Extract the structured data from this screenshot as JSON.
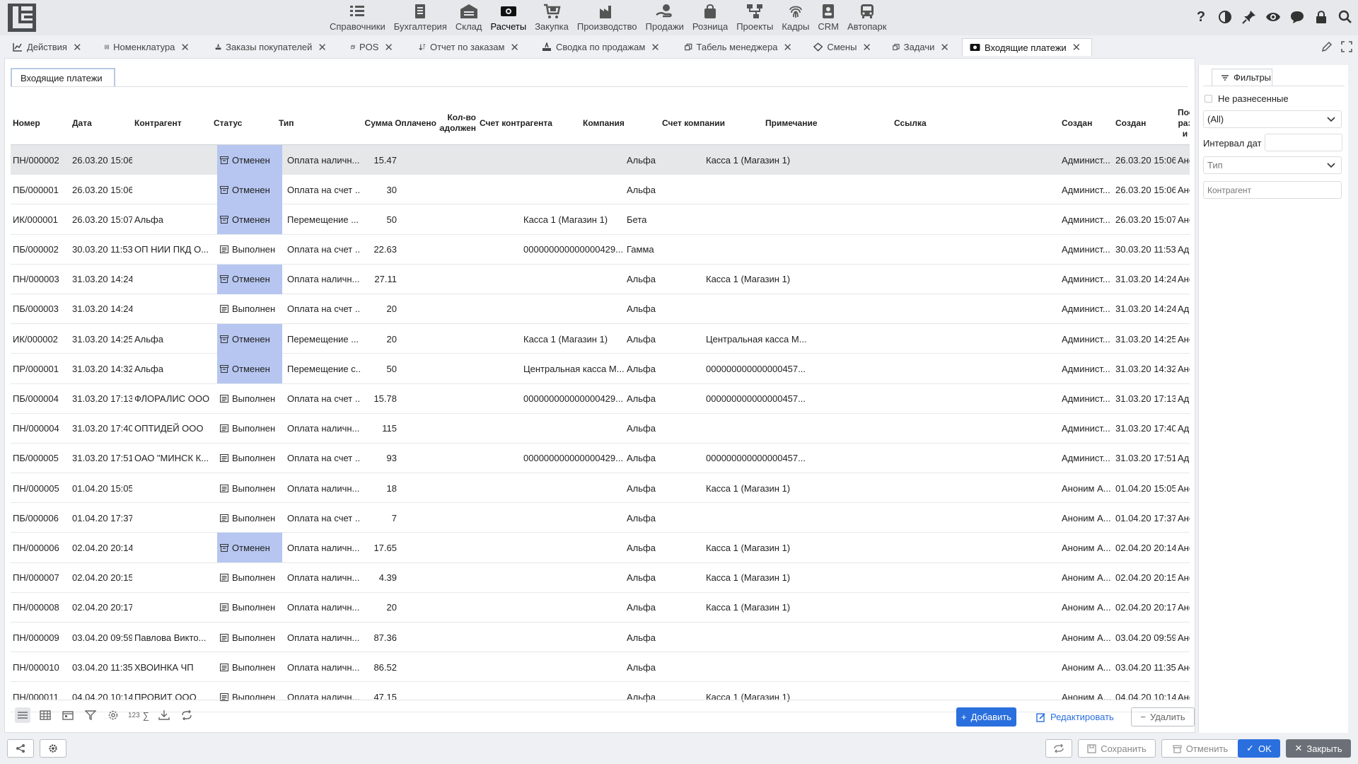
{
  "nav": {
    "modules": [
      {
        "label": "Справочники",
        "icon": "list-icon"
      },
      {
        "label": "Бухгалтерия",
        "icon": "ledger-icon"
      },
      {
        "label": "Склад",
        "icon": "warehouse-icon"
      },
      {
        "label": "Расчеты",
        "icon": "cash-icon"
      },
      {
        "label": "Закупка",
        "icon": "cart-icon"
      },
      {
        "label": "Производство",
        "icon": "factory-icon"
      },
      {
        "label": "Продажи",
        "icon": "hand-money-icon"
      },
      {
        "label": "Розница",
        "icon": "shopping-bag-icon"
      },
      {
        "label": "Проекты",
        "icon": "hierarchy-icon"
      },
      {
        "label": "Кадры",
        "icon": "fingerprint-icon"
      },
      {
        "label": "CRM",
        "icon": "contact-card-icon"
      },
      {
        "label": "Автопарк",
        "icon": "bus-icon"
      }
    ],
    "active_module": "Расчеты"
  },
  "tabs": [
    {
      "label": "Действия",
      "icon": "chart-icon"
    },
    {
      "label": "Номенклатура",
      "icon": "inventory-icon"
    },
    {
      "label": "Заказы покупателей",
      "icon": "order-icon"
    },
    {
      "label": "POS",
      "icon": "pos-icon"
    },
    {
      "label": "Отчет по заказам",
      "icon": "sort-icon"
    },
    {
      "label": "Сводка по продажам",
      "icon": "summary-icon"
    },
    {
      "label": "Табель менеджера",
      "icon": "copy-icon"
    },
    {
      "label": "Смены",
      "icon": "shift-icon"
    },
    {
      "label": "Задачи",
      "icon": "tasks-icon"
    },
    {
      "label": "Входящие платежи",
      "icon": "cash-icon",
      "active": true
    }
  ],
  "subtab": "Входящие платежи",
  "columns": {
    "number": "Номер",
    "date": "Дата",
    "counterparty": "Контрагент",
    "status": "Статус",
    "type": "Тип",
    "sum": "Сумма",
    "paid": "Оплачено",
    "debt_count_1": "Кол-во",
    "debt_count_2": "задолжен",
    "counterparty_account": "Счет контрагента",
    "company": "Компания",
    "company_account": "Счет компании",
    "note": "Примечание",
    "link": "Ссылка",
    "created_by": "Создан",
    "created_at": "Создан",
    "last_1": "Посл",
    "last_2": "раз и"
  },
  "rows": [
    {
      "number": "ПН/000002",
      "date": "26.03.20 15:06",
      "counterparty": "",
      "status": "Отменен",
      "type": "Оплата наличн...",
      "sum": "15.47",
      "cp_account": "",
      "company": "Альфа",
      "company_account": "Касса 1 (Магазин 1)",
      "created_by": "Админист...",
      "created_at": "26.03.20 15:06",
      "last": "Анон"
    },
    {
      "number": "ПБ/000001",
      "date": "26.03.20 15:06",
      "counterparty": "",
      "status": "Отменен",
      "type": "Оплата на счет ...",
      "sum": "30",
      "cp_account": "",
      "company": "Альфа",
      "company_account": "",
      "created_by": "Админист...",
      "created_at": "26.03.20 15:06",
      "last": "Анон"
    },
    {
      "number": "ИК/000001",
      "date": "26.03.20 15:07",
      "counterparty": "Альфа",
      "status": "Отменен",
      "type": "Перемещение ...",
      "sum": "50",
      "cp_account": "Касса 1 (Магазин 1)",
      "company": "Бета",
      "company_account": "",
      "created_by": "Админист...",
      "created_at": "26.03.20 15:07",
      "last": "Анон"
    },
    {
      "number": "ПБ/000002",
      "date": "30.03.20 11:53",
      "counterparty": "ОП НИИ ПКД О...",
      "status": "Выполнен",
      "type": "Оплата на счет ...",
      "sum": "22.63",
      "cp_account": "000000000000000429...",
      "company": "Гамма",
      "company_account": "",
      "created_by": "Админист...",
      "created_at": "30.03.20 11:53",
      "last": "Адм"
    },
    {
      "number": "ПН/000003",
      "date": "31.03.20 14:24",
      "counterparty": "",
      "status": "Отменен",
      "type": "Оплата наличн...",
      "sum": "27.11",
      "cp_account": "",
      "company": "Альфа",
      "company_account": "Касса 1 (Магазин 1)",
      "created_by": "Админист...",
      "created_at": "31.03.20 14:24",
      "last": "Анон"
    },
    {
      "number": "ПБ/000003",
      "date": "31.03.20 14:24",
      "counterparty": "",
      "status": "Выполнен",
      "type": "Оплата на счет ...",
      "sum": "20",
      "cp_account": "",
      "company": "Альфа",
      "company_account": "",
      "created_by": "Админист...",
      "created_at": "31.03.20 14:24",
      "last": "Адм"
    },
    {
      "number": "ИК/000002",
      "date": "31.03.20 14:25",
      "counterparty": "Альфа",
      "status": "Отменен",
      "type": "Перемещение ...",
      "sum": "20",
      "cp_account": "Касса 1 (Магазин 1)",
      "company": "Альфа",
      "company_account": "Центральная касса М...",
      "created_by": "Админист...",
      "created_at": "31.03.20 14:25",
      "last": "Анон"
    },
    {
      "number": "ПР/000001",
      "date": "31.03.20 14:32",
      "counterparty": "Альфа",
      "status": "Отменен",
      "type": "Перемещение с...",
      "sum": "50",
      "cp_account": "Центральная касса М...",
      "company": "Альфа",
      "company_account": "000000000000000457...",
      "created_by": "Админист...",
      "created_at": "31.03.20 14:32",
      "last": "Анон"
    },
    {
      "number": "ПБ/000004",
      "date": "31.03.20 17:13",
      "counterparty": "ФЛОРАЛИС ООО",
      "status": "Выполнен",
      "type": "Оплата на счет ...",
      "sum": "15.78",
      "cp_account": "000000000000000429...",
      "company": "Альфа",
      "company_account": "000000000000000457...",
      "created_by": "Админист...",
      "created_at": "31.03.20 17:13",
      "last": "Адм"
    },
    {
      "number": "ПН/000004",
      "date": "31.03.20 17:40",
      "counterparty": "ОПТИДЕЙ ООО",
      "status": "Выполнен",
      "type": "Оплата наличн...",
      "sum": "115",
      "cp_account": "",
      "company": "Альфа",
      "company_account": "",
      "created_by": "Админист...",
      "created_at": "31.03.20 17:40",
      "last": "Адм"
    },
    {
      "number": "ПБ/000005",
      "date": "31.03.20 17:51",
      "counterparty": "ОАО \"МИНСК К...",
      "status": "Выполнен",
      "type": "Оплата на счет ...",
      "sum": "93",
      "cp_account": "000000000000000429...",
      "company": "Альфа",
      "company_account": "000000000000000457...",
      "created_by": "Админист...",
      "created_at": "31.03.20 17:51",
      "last": "Адм"
    },
    {
      "number": "ПН/000005",
      "date": "01.04.20 15:05",
      "counterparty": "",
      "status": "Выполнен",
      "type": "Оплата наличн...",
      "sum": "18",
      "cp_account": "",
      "company": "Альфа",
      "company_account": "Касса 1 (Магазин 1)",
      "created_by": "Аноним А...",
      "created_at": "01.04.20 15:05",
      "last": "Анон"
    },
    {
      "number": "ПБ/000006",
      "date": "01.04.20 17:37",
      "counterparty": "",
      "status": "Выполнен",
      "type": "Оплата на счет ...",
      "sum": "7",
      "cp_account": "",
      "company": "Альфа",
      "company_account": "",
      "created_by": "Аноним А...",
      "created_at": "01.04.20 17:37",
      "last": "Анон"
    },
    {
      "number": "ПН/000006",
      "date": "02.04.20 20:14",
      "counterparty": "",
      "status": "Отменен",
      "type": "Оплата наличн...",
      "sum": "17.65",
      "cp_account": "",
      "company": "Альфа",
      "company_account": "Касса 1 (Магазин 1)",
      "created_by": "Аноним А...",
      "created_at": "02.04.20 20:14",
      "last": "Анон"
    },
    {
      "number": "ПН/000007",
      "date": "02.04.20 20:15",
      "counterparty": "",
      "status": "Выполнен",
      "type": "Оплата наличн...",
      "sum": "4.39",
      "cp_account": "",
      "company": "Альфа",
      "company_account": "Касса 1 (Магазин 1)",
      "created_by": "Аноним А...",
      "created_at": "02.04.20 20:15",
      "last": "Анон"
    },
    {
      "number": "ПН/000008",
      "date": "02.04.20 20:17",
      "counterparty": "",
      "status": "Выполнен",
      "type": "Оплата наличн...",
      "sum": "20",
      "cp_account": "",
      "company": "Альфа",
      "company_account": "Касса 1 (Магазин 1)",
      "created_by": "Аноним А...",
      "created_at": "02.04.20 20:17",
      "last": "Анон"
    },
    {
      "number": "ПН/000009",
      "date": "03.04.20 09:59",
      "counterparty": "Павлова Викто...",
      "status": "Выполнен",
      "type": "Оплата наличн...",
      "sum": "87.36",
      "cp_account": "",
      "company": "Альфа",
      "company_account": "",
      "created_by": "Аноним А...",
      "created_at": "03.04.20 09:59",
      "last": "Анон"
    },
    {
      "number": "ПН/000010",
      "date": "03.04.20 11:35",
      "counterparty": "ХВОИНКА ЧП",
      "status": "Выполнен",
      "type": "Оплата наличн...",
      "sum": "86.52",
      "cp_account": "",
      "company": "Альфа",
      "company_account": "",
      "created_by": "Аноним А...",
      "created_at": "03.04.20 11:35",
      "last": "Анон"
    },
    {
      "number": "ПН/000011",
      "date": "04.04.20 10:14",
      "counterparty": "ПРОВИТ ООО",
      "status": "Выполнен",
      "type": "Оплата наличн...",
      "sum": "47.15",
      "cp_account": "",
      "company": "Альфа",
      "company_account": "Касса 1 (Магазин 1)",
      "created_by": "Аноним А...",
      "created_at": "04.04.20 10:14",
      "last": "Анон"
    }
  ],
  "bottom": {
    "count_label": "123",
    "sum_label": "∑",
    "add": "Добавить",
    "edit": "Редактировать",
    "delete": "Удалить"
  },
  "filters": {
    "tab": "Фильтры",
    "not_distributed": "Не разнесенные",
    "select_all": "(All)",
    "date_interval": "Интервал дат",
    "type_placeholder": "Тип",
    "counterparty_placeholder": "Контрагент"
  },
  "footer": {
    "save": "Сохранить",
    "cancel": "Отменить",
    "ok": "OK",
    "close": "Закрыть"
  },
  "colors": {
    "accent": "#2a6fde",
    "cancelled_status_bg": "#b6c6f0",
    "selected_row_bg": "#e6e7e9",
    "close_button": "#6b7078"
  }
}
